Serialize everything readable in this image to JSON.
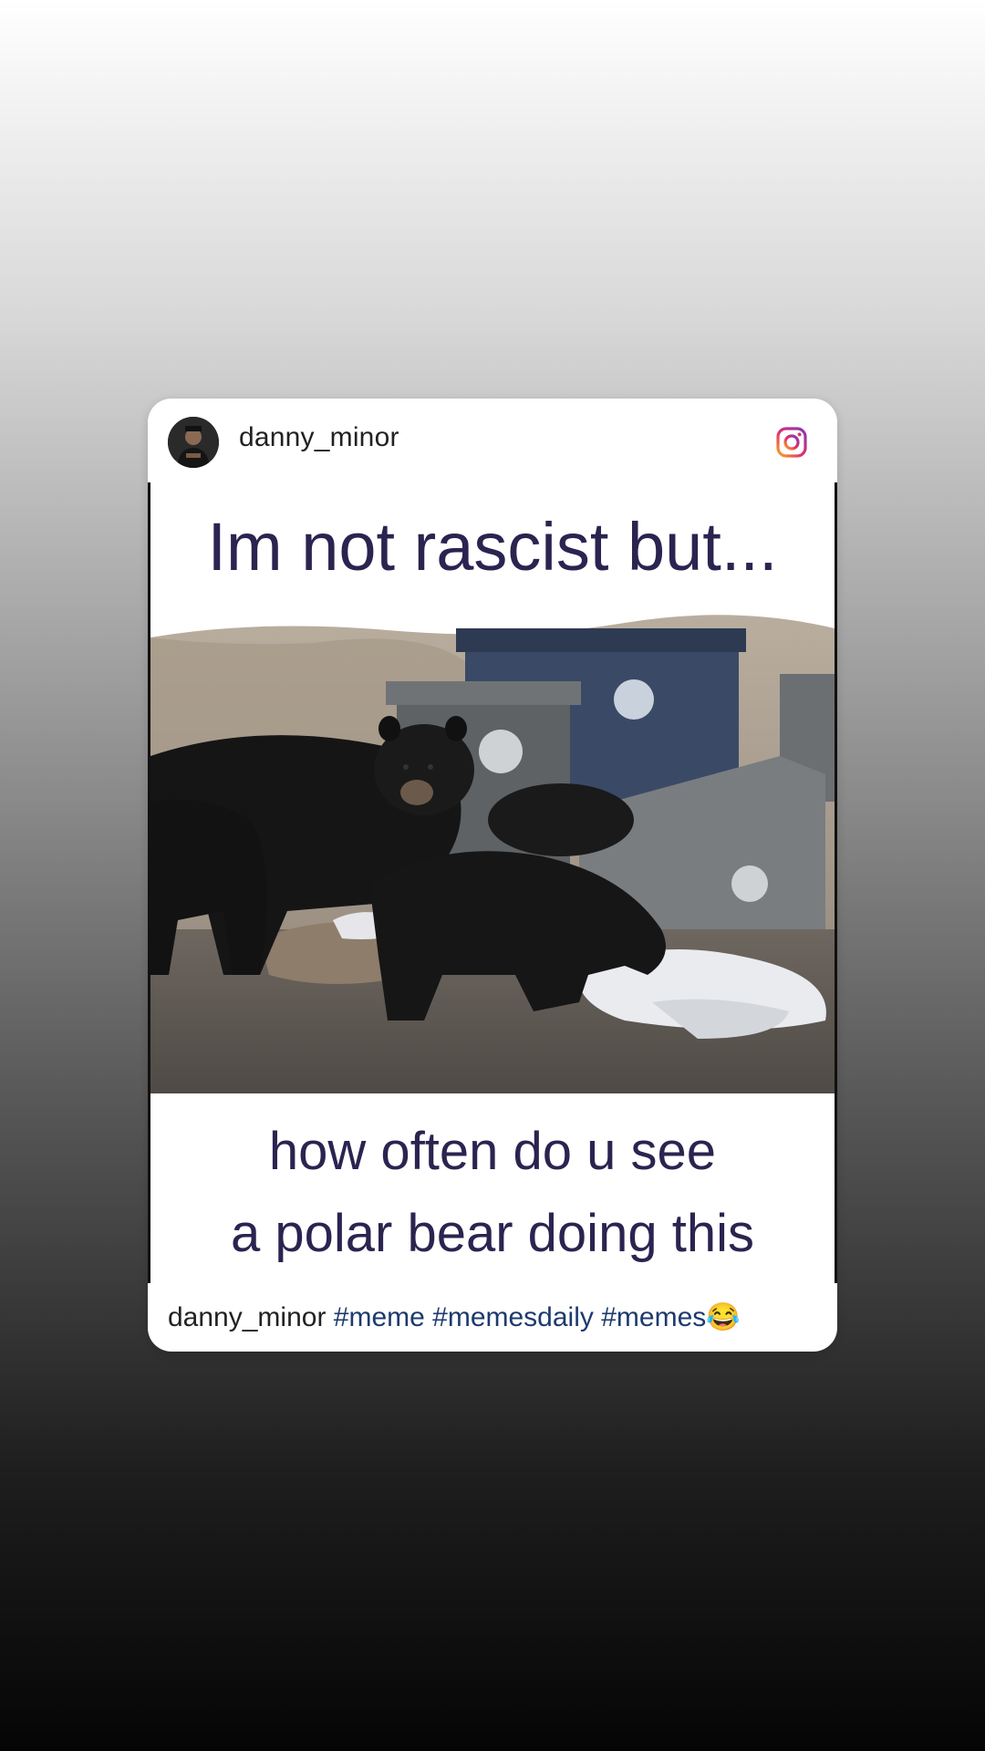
{
  "post": {
    "username": "danny_minor",
    "platform_icon": "instagram-icon",
    "avatar_icon": "profile-avatar"
  },
  "meme": {
    "top_text": "Im not rascist but...",
    "bottom_line_1": "how often do u see",
    "bottom_line_2": "a polar bear doing this"
  },
  "caption": {
    "username": "danny_minor",
    "hashtags": "#meme #memesdaily #memes",
    "emoji": "😂"
  },
  "colors": {
    "meme_text": "#2a2450",
    "hashtag": "#1e3a6e"
  }
}
